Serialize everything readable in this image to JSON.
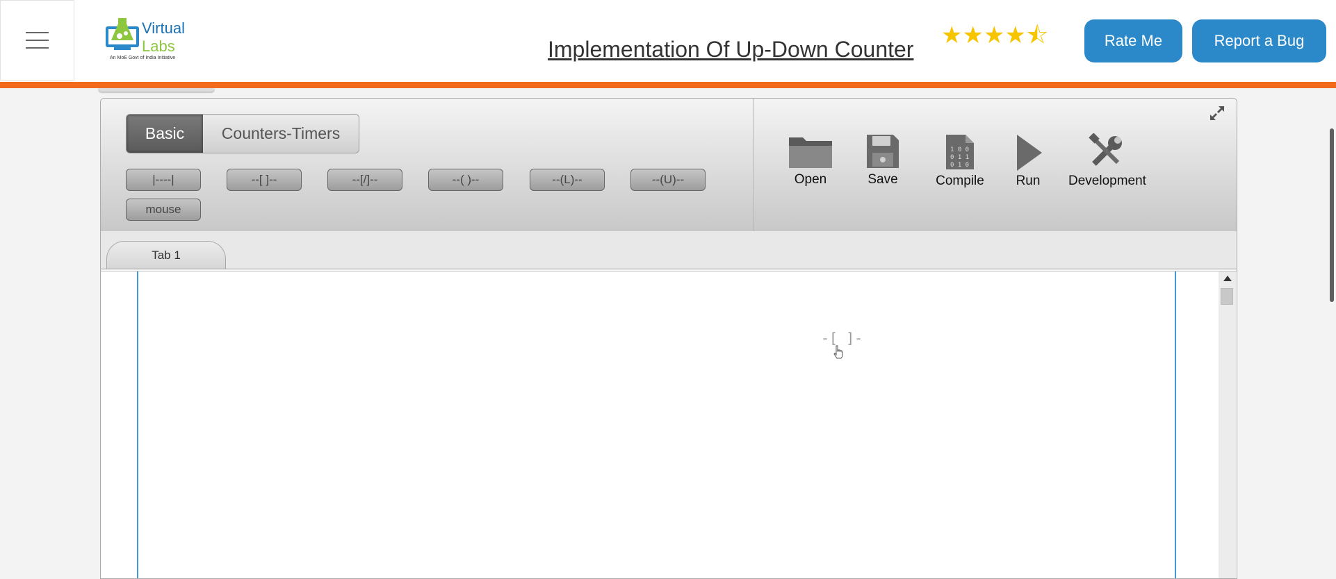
{
  "header": {
    "logo": {
      "line1": "Virtual",
      "line2": "Labs",
      "tagline": "An MoE Govt of India Initiative"
    },
    "title": "Implementation Of Up-Down Counter",
    "rating": 4.5,
    "rate_label": "Rate Me",
    "bug_label": "Report a Bug"
  },
  "toolbar": {
    "mode_tabs": [
      "Basic",
      "Counters-Timers"
    ],
    "active_mode": "Basic",
    "elements": [
      "|----|",
      "--[ ]--",
      "--[/]--",
      "--( )--",
      "--(L)--",
      "--(U)--",
      "mouse"
    ],
    "tools": [
      "Open",
      "Save",
      "Compile",
      "Run",
      "Development"
    ]
  },
  "tabs": [
    "Tab 1"
  ],
  "canvas": {
    "cursor_symbol": "-[ ]-"
  },
  "colors": {
    "accent": "#2b88c9",
    "orange": "#f26b1d",
    "star": "#f7c400",
    "rail": "#3f9ad8"
  }
}
